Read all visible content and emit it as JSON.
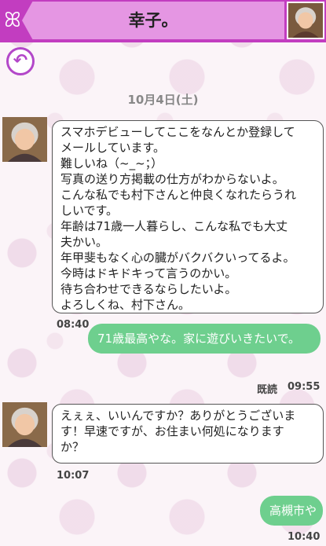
{
  "header": {
    "title": "幸子。",
    "logo_glyph": "ꕤ",
    "logo_icon": "ribbon-logo-icon",
    "accent_color": "#c23dc0"
  },
  "back_icon": "back-arrow-icon",
  "back_glyph": "↶",
  "date": "10月4日(土)",
  "messages": [
    {
      "direction": "incoming",
      "text": "スマホデビューしてここをなんとか登録して\nメールしています。\n難しいね（~_~；）\n写真の送り方掲載の仕方がわからないよ。\nこんな私でも村下さんと仲良くなれたらうれ\nしいです。\n年齢は71歳一人暮らし、こんな私でも大丈\n夫かい。\n年甲斐もなく心の臓がバクバクいってるよ。\n今時はドキドキって言うのかい。\n待ち合わせできるならしたいよ。\nよろしくね、村下さん。",
      "time": "08:40"
    },
    {
      "direction": "outgoing",
      "text": "71歳最高やな。家に遊びいきたいで。",
      "read": "既読",
      "time": "09:55"
    },
    {
      "direction": "incoming",
      "text": "えぇぇ、いいんですか？ありがとうございま\nす！早速ですが、お住まい何処になります\nか？",
      "time": "10:07"
    },
    {
      "direction": "outgoing",
      "text": "高槻市や",
      "time": "10:40"
    }
  ]
}
